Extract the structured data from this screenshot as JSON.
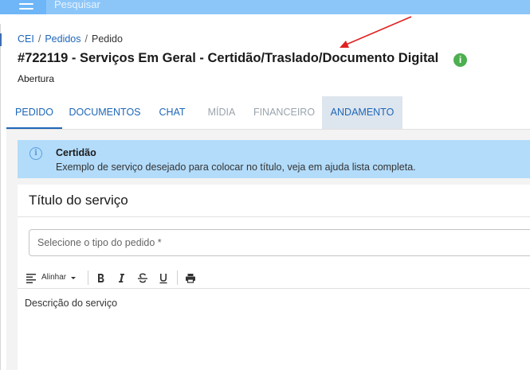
{
  "topbar": {
    "search_placeholder": "Pesquisar",
    "menu_icon": "hamburger-menu-icon"
  },
  "breadcrumb": {
    "items": [
      "CEI",
      "Pedidos"
    ],
    "current": "Pedido",
    "separator": "/"
  },
  "page": {
    "title": "#722119 - Serviços Em Geral - Certidão/Traslado/Documento Digital",
    "info_glyph": "i",
    "status": "Abertura"
  },
  "tabs": [
    {
      "label": "PEDIDO",
      "state": "active"
    },
    {
      "label": "DOCUMENTOS",
      "state": "normal"
    },
    {
      "label": "CHAT",
      "state": "normal"
    },
    {
      "label": "MÍDIA",
      "state": "disabled"
    },
    {
      "label": "FINANCEIRO",
      "state": "disabled"
    },
    {
      "label": "ANDAMENTO",
      "state": "highlight"
    }
  ],
  "alert": {
    "icon_glyph": "i",
    "title": "Certidão",
    "message": "Exemplo de serviço desejado para colocar no título, veja em ajuda lista completa."
  },
  "form": {
    "card_title": "Título do serviço",
    "select_placeholder": "Selecione o tipo do pedido *",
    "toolbar": {
      "align_label": "Alinhar"
    },
    "editor_text": "Descrição do serviço"
  },
  "colors": {
    "topbar": "#6eb6f7",
    "primary": "#1e66b8",
    "alert_bg": "#b3dcfb",
    "success": "#4caf50",
    "annotation_arrow": "#e02020"
  }
}
